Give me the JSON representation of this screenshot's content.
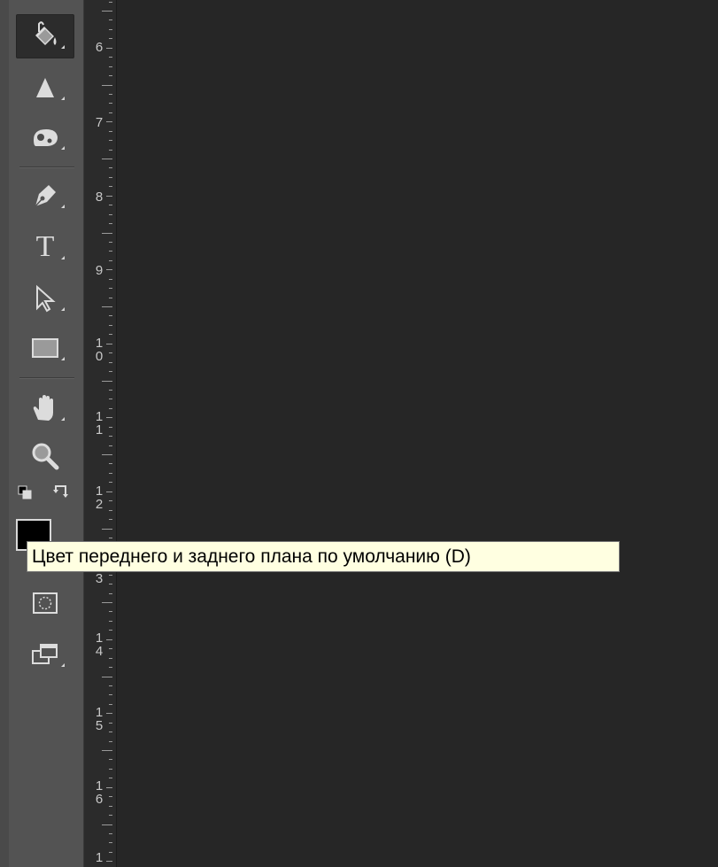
{
  "tools": [
    {
      "name": "paint-bucket-icon",
      "active": true
    },
    {
      "name": "sharpen-icon",
      "active": false
    },
    {
      "name": "sponge-icon",
      "active": false
    },
    {
      "name": "pen-icon",
      "active": false
    },
    {
      "name": "type-icon",
      "active": false,
      "glyph": "T"
    },
    {
      "name": "path-selection-icon",
      "active": false
    },
    {
      "name": "rectangle-icon",
      "active": false
    },
    {
      "name": "hand-icon",
      "active": false
    },
    {
      "name": "zoom-icon",
      "active": false
    },
    {
      "name": "quick-mask-icon",
      "active": false
    },
    {
      "name": "screen-mode-icon",
      "active": false
    }
  ],
  "colors": {
    "foreground": "#000000",
    "panel": "#535353",
    "workspace": "#262626",
    "tooltip_bg": "#ffffe1"
  },
  "ruler": {
    "labels": [
      "6",
      "7",
      "8",
      "9",
      "1\n0",
      "1\n1",
      "1\n2",
      "3",
      "1\n4",
      "1\n5",
      "1\n6",
      "1"
    ]
  },
  "tooltip": {
    "text": "Цвет переднего и заднего плана по умолчанию (D)"
  }
}
